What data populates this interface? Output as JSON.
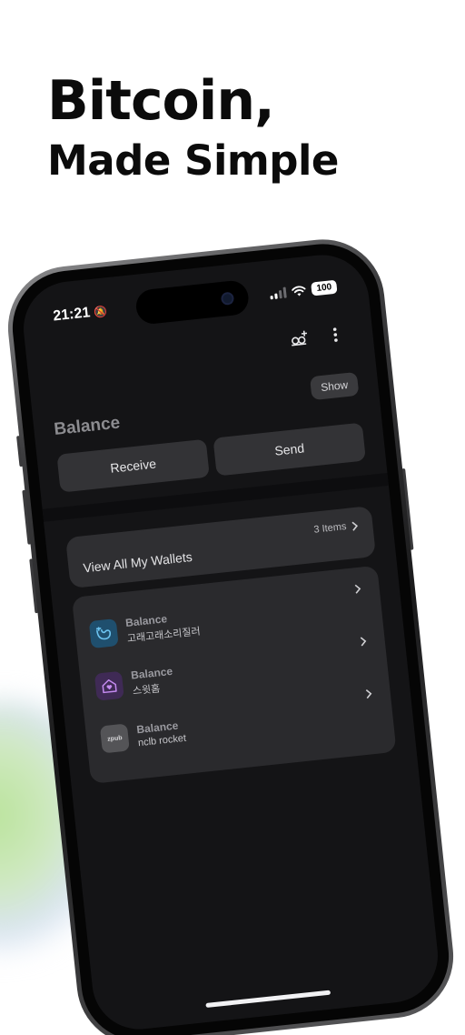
{
  "headline": {
    "line1": "Bitcoin,",
    "line2": "Made Simple"
  },
  "status_bar": {
    "time": "21:21",
    "battery": "100"
  },
  "header": {
    "show_label": "Show",
    "balance_title": "Balance"
  },
  "actions": {
    "receive_label": "Receive",
    "send_label": "Send"
  },
  "wallets_summary": {
    "label": "View All My Wallets",
    "count": "3 Items"
  },
  "wallets": [
    {
      "balance_label": "Balance",
      "name": "고래고래소리질러",
      "icon": "whale-icon"
    },
    {
      "balance_label": "Balance",
      "name": "스윗홈",
      "icon": "home-heart-icon"
    },
    {
      "balance_label": "Balance",
      "name": "nclb rocket",
      "icon": "zpub-icon",
      "icon_text": "zpub"
    }
  ],
  "colors": {
    "screen_bg": "#141416",
    "card_bg": "#2f2f32",
    "accent_blue": "#6cc3f0",
    "accent_purple": "#c48af0",
    "glow_green": "#b9e39a"
  }
}
